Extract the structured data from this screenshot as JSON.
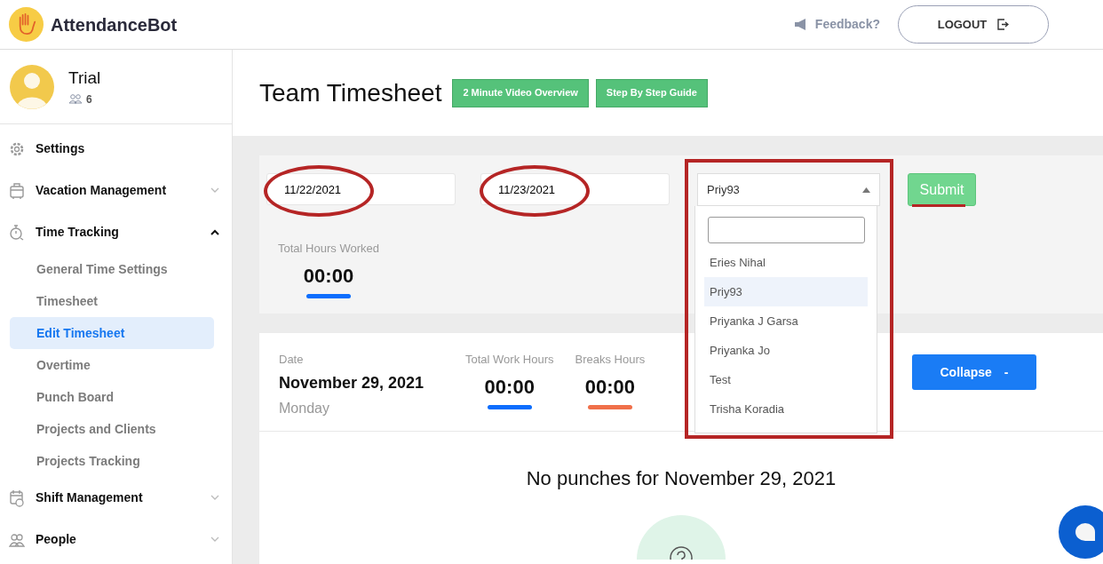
{
  "app": {
    "name": "AttendanceBot"
  },
  "header": {
    "feedback": "Feedback?",
    "logout": "LOGOUT"
  },
  "user": {
    "name": "Trial",
    "members": "6"
  },
  "sidebar": {
    "items": [
      {
        "label": "Settings",
        "kind": "link"
      },
      {
        "label": "Vacation Management",
        "kind": "group",
        "expanded": false
      },
      {
        "label": "Time Tracking",
        "kind": "group",
        "expanded": true,
        "children": [
          {
            "label": "General Time Settings",
            "selected": false
          },
          {
            "label": "Timesheet",
            "selected": false
          },
          {
            "label": "Edit Timesheet",
            "selected": true
          },
          {
            "label": "Overtime",
            "selected": false
          },
          {
            "label": "Punch Board",
            "selected": false
          },
          {
            "label": "Projects and Clients",
            "selected": false
          },
          {
            "label": "Projects Tracking",
            "selected": false
          }
        ]
      },
      {
        "label": "Shift Management",
        "kind": "group",
        "expanded": false
      },
      {
        "label": "People",
        "kind": "group",
        "expanded": false
      }
    ]
  },
  "page": {
    "title": "Team Timesheet",
    "guide_buttons": [
      "2 Minute Video Overview",
      "Step By Step Guide"
    ]
  },
  "filters": {
    "start_date": "11/22/2021",
    "end_date": "11/23/2021",
    "submit": "Submit",
    "employee": {
      "value": "Priy93",
      "expanded": true,
      "options": [
        {
          "label": "Eries Nihal",
          "selected": false
        },
        {
          "label": "Priy93",
          "selected": true
        },
        {
          "label": "Priyanka J Garsa",
          "selected": false
        },
        {
          "label": "Priyanka Jo",
          "selected": false
        },
        {
          "label": "Test",
          "selected": false
        },
        {
          "label": "Trisha Koradia",
          "selected": false
        }
      ]
    },
    "total": {
      "label": "Total Hours Worked",
      "value": "00:00"
    }
  },
  "day_card": {
    "date_label": "Date",
    "date": "November 29, 2021",
    "weekday": "Monday",
    "stats": [
      {
        "label": "Total Work Hours",
        "value": "00:00",
        "color": "#0d6efd"
      },
      {
        "label": "Breaks Hours",
        "value": "00:00",
        "color": "#f0704a"
      }
    ],
    "collapse": "Collapse",
    "collapse_symbol": "-",
    "empty_message": "No punches for November 29, 2021"
  }
}
